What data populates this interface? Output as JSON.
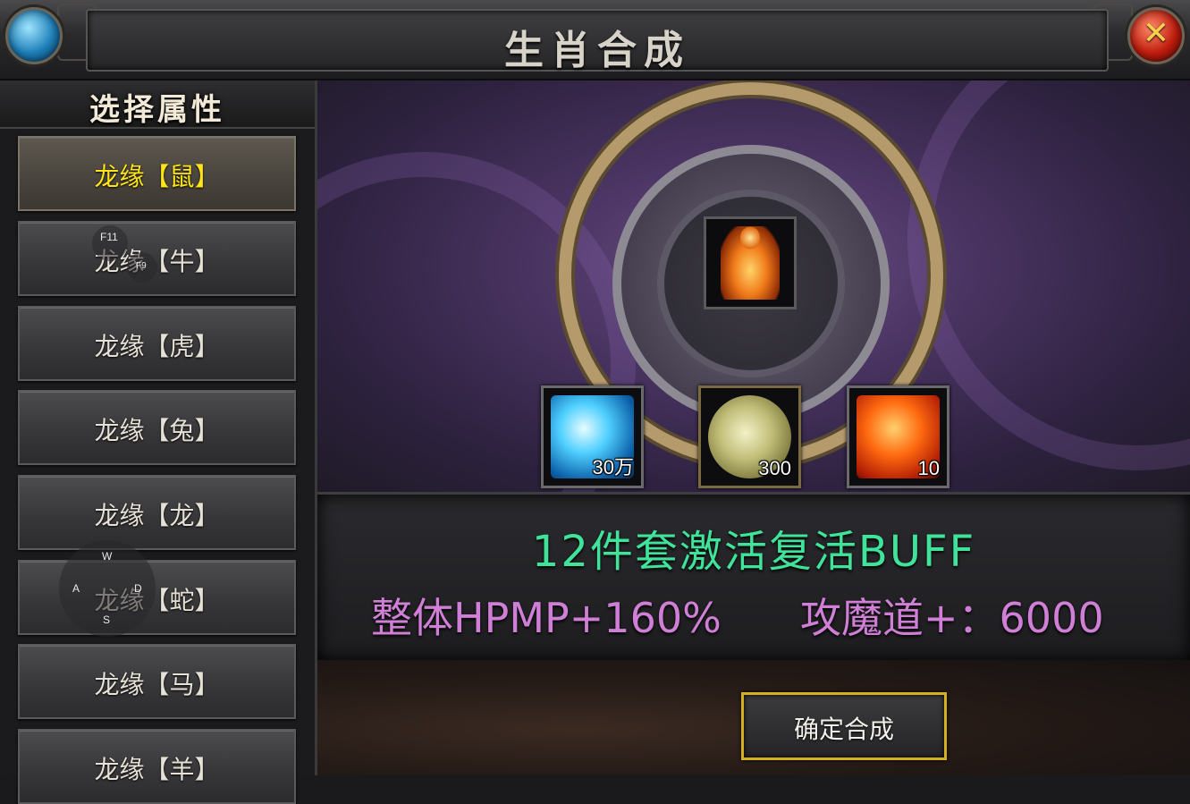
{
  "window": {
    "title": "生肖合成",
    "close_icon": "close-x-icon",
    "menu_icon": "blue-orb-icon"
  },
  "sidebar": {
    "header": "选择属性",
    "items": [
      {
        "label": "龙缘【鼠】",
        "selected": true
      },
      {
        "label": "龙缘【牛】",
        "selected": false
      },
      {
        "label": "龙缘【虎】",
        "selected": false
      },
      {
        "label": "龙缘【兔】",
        "selected": false
      },
      {
        "label": "龙缘【龙】",
        "selected": false
      },
      {
        "label": "龙缘【蛇】",
        "selected": false
      },
      {
        "label": "龙缘【马】",
        "selected": false
      },
      {
        "label": "龙缘【羊】",
        "selected": false
      }
    ]
  },
  "synthesis": {
    "result_item_icon": "golden-zodiac-rat-figurine-icon",
    "materials": [
      {
        "icon": "blue-diamond-icon",
        "count": "30万"
      },
      {
        "icon": "silver-coin-stack-icon",
        "count": "300"
      },
      {
        "icon": "orange-gem-icon",
        "count": "10"
      }
    ]
  },
  "bonus": {
    "set_buff": "12件套激活复活BUFF",
    "hpmp": "整体HPMP+160%",
    "attack": "攻魔道+：6000"
  },
  "actions": {
    "confirm_label": "确定合成"
  },
  "overlay": {
    "key_f11": "F11",
    "key_f9": "F9",
    "key_w": "W",
    "key_a": "A",
    "key_s": "S",
    "key_d": "D"
  },
  "colors": {
    "selected_text": "#ffe418",
    "buff_text": "#3fe39a",
    "stat_text": "#cf7fd6",
    "confirm_border": "#d4b01e"
  }
}
